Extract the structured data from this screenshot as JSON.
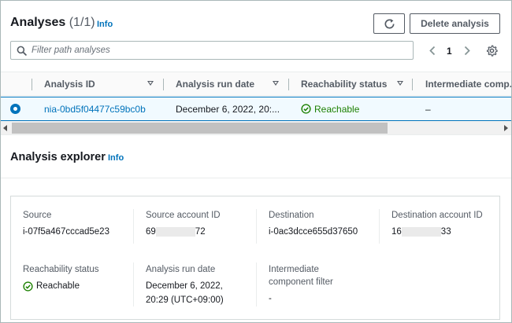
{
  "analyses": {
    "title": "Analyses",
    "count": "(1/1)",
    "info": "Info",
    "delete_label": "Delete analysis",
    "refresh_icon": "refresh-icon",
    "search": {
      "placeholder": "Filter path analyses",
      "value": ""
    },
    "pagination": {
      "current": "1"
    },
    "columns": [
      "Analysis ID",
      "Analysis run date",
      "Reachability status",
      "Intermediate comp..."
    ],
    "rows": [
      {
        "id": "nia-0bd5f04477c59bc0b",
        "run_date": "December 6, 2022, 20:...",
        "status": "Reachable",
        "intermediate": "–",
        "selected": true
      }
    ]
  },
  "explorer": {
    "title": "Analysis explorer",
    "info": "Info",
    "fields": {
      "source": {
        "label": "Source",
        "value": "i-07f5a467cccad5e23"
      },
      "source_account": {
        "label": "Source account ID",
        "prefix": "69",
        "suffix": "72"
      },
      "destination": {
        "label": "Destination",
        "value": "i-0ac3dcce655d37650"
      },
      "destination_account": {
        "label": "Destination account ID",
        "prefix": "16",
        "suffix": "33"
      },
      "reachability": {
        "label": "Reachability status",
        "value": "Reachable"
      },
      "run_date": {
        "label": "Analysis run date",
        "line1": "December 6, 2022,",
        "line2": "20:29 (UTC+09:00)"
      },
      "intermediate": {
        "label_line1": "Intermediate",
        "label_line2": "component filter",
        "value": "-"
      }
    }
  },
  "colors": {
    "link": "#0073bb",
    "success": "#1d8102",
    "selected_row_bg": "#f1faff",
    "border": "#aab7b8"
  }
}
